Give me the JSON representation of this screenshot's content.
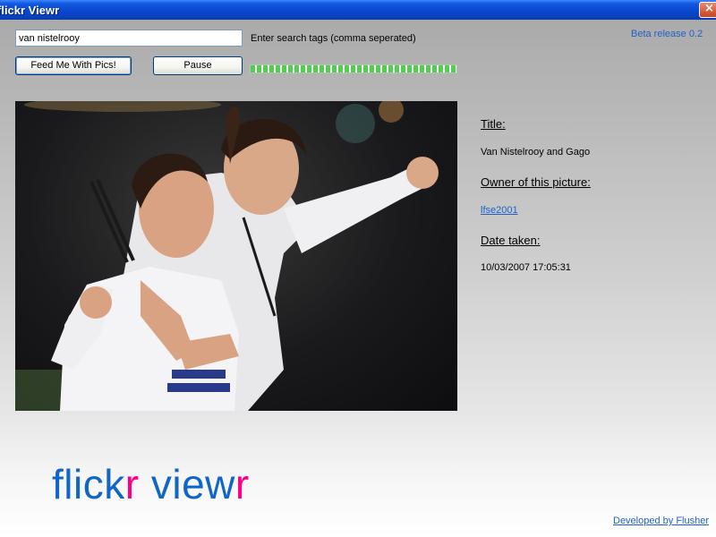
{
  "window": {
    "title": "flickr Viewr",
    "close_glyph": "×"
  },
  "search": {
    "value": "van nistelrooy",
    "hint": "Enter search tags (comma seperated)"
  },
  "version": "Beta release 0.2",
  "buttons": {
    "feed_label": "Feed Me With Pics!",
    "pause_label": "Pause"
  },
  "progress": {
    "fraction": 1.0,
    "color": "#4fd14f"
  },
  "photo": {
    "icon": "photo"
  },
  "info": {
    "title_label": "Title:",
    "title_value": "Van Nistelrooy and Gago",
    "owner_label": "Owner of this picture:",
    "owner_value": "lfse2001",
    "date_label": "Date taken:",
    "date_value": "10/03/2007 17:05:31"
  },
  "logo": {
    "part1": "flick",
    "part2": "r",
    "part3": " view",
    "part4": "r",
    "color_blue": "#1066c8",
    "color_pink": "#ff0084"
  },
  "footer": {
    "developed_by": "Developed by Flusher"
  }
}
